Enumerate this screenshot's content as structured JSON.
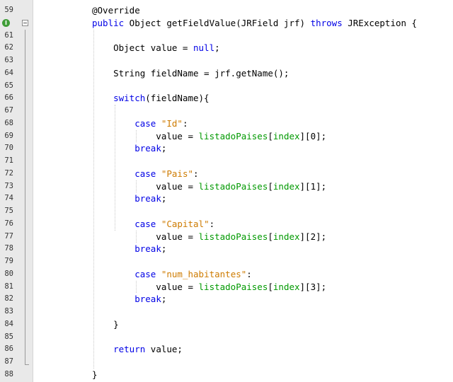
{
  "editor": {
    "override_marker": "I",
    "lines": [
      {
        "number": "59",
        "tokens": [
          {
            "t": "@Override",
            "k": "plain"
          }
        ]
      },
      {
        "number": "",
        "tokens": [
          {
            "t": "public",
            "k": "keyword"
          },
          {
            "t": " Object getFieldValue(JRField jrf) ",
            "k": "plain"
          },
          {
            "t": "throws",
            "k": "keyword"
          },
          {
            "t": " JRException {",
            "k": "plain"
          }
        ]
      },
      {
        "number": "61",
        "tokens": []
      },
      {
        "number": "62",
        "tokens": [
          {
            "t": "    Object value = ",
            "k": "plain"
          },
          {
            "t": "null",
            "k": "keyword"
          },
          {
            "t": ";",
            "k": "plain"
          }
        ]
      },
      {
        "number": "63",
        "tokens": []
      },
      {
        "number": "64",
        "tokens": [
          {
            "t": "    String fieldName = jrf.getName();",
            "k": "plain"
          }
        ]
      },
      {
        "number": "65",
        "tokens": []
      },
      {
        "number": "66",
        "tokens": [
          {
            "t": "    ",
            "k": "plain"
          },
          {
            "t": "switch",
            "k": "keyword"
          },
          {
            "t": "(fieldName){",
            "k": "plain"
          }
        ]
      },
      {
        "number": "67",
        "tokens": []
      },
      {
        "number": "68",
        "tokens": [
          {
            "t": "        ",
            "k": "plain"
          },
          {
            "t": "case",
            "k": "keyword"
          },
          {
            "t": " ",
            "k": "plain"
          },
          {
            "t": "\"Id\"",
            "k": "string"
          },
          {
            "t": ":",
            "k": "plain"
          }
        ]
      },
      {
        "number": "69",
        "tokens": [
          {
            "t": "            value = ",
            "k": "plain"
          },
          {
            "t": "listadoPaises",
            "k": "field"
          },
          {
            "t": "[",
            "k": "plain"
          },
          {
            "t": "index",
            "k": "field"
          },
          {
            "t": "][0];",
            "k": "plain"
          }
        ]
      },
      {
        "number": "70",
        "tokens": [
          {
            "t": "        ",
            "k": "plain"
          },
          {
            "t": "break",
            "k": "keyword"
          },
          {
            "t": ";",
            "k": "plain"
          }
        ]
      },
      {
        "number": "71",
        "tokens": []
      },
      {
        "number": "72",
        "tokens": [
          {
            "t": "        ",
            "k": "plain"
          },
          {
            "t": "case",
            "k": "keyword"
          },
          {
            "t": " ",
            "k": "plain"
          },
          {
            "t": "\"Pais\"",
            "k": "string"
          },
          {
            "t": ":",
            "k": "plain"
          }
        ]
      },
      {
        "number": "73",
        "tokens": [
          {
            "t": "            value = ",
            "k": "plain"
          },
          {
            "t": "listadoPaises",
            "k": "field"
          },
          {
            "t": "[",
            "k": "plain"
          },
          {
            "t": "index",
            "k": "field"
          },
          {
            "t": "][1];",
            "k": "plain"
          }
        ]
      },
      {
        "number": "74",
        "tokens": [
          {
            "t": "        ",
            "k": "plain"
          },
          {
            "t": "break",
            "k": "keyword"
          },
          {
            "t": ";",
            "k": "plain"
          }
        ]
      },
      {
        "number": "75",
        "tokens": []
      },
      {
        "number": "76",
        "tokens": [
          {
            "t": "        ",
            "k": "plain"
          },
          {
            "t": "case",
            "k": "keyword"
          },
          {
            "t": " ",
            "k": "plain"
          },
          {
            "t": "\"Capital\"",
            "k": "string"
          },
          {
            "t": ":",
            "k": "plain"
          }
        ]
      },
      {
        "number": "77",
        "tokens": [
          {
            "t": "            value = ",
            "k": "plain"
          },
          {
            "t": "listadoPaises",
            "k": "field"
          },
          {
            "t": "[",
            "k": "plain"
          },
          {
            "t": "index",
            "k": "field"
          },
          {
            "t": "][2];",
            "k": "plain"
          }
        ]
      },
      {
        "number": "78",
        "tokens": [
          {
            "t": "        ",
            "k": "plain"
          },
          {
            "t": "break",
            "k": "keyword"
          },
          {
            "t": ";",
            "k": "plain"
          }
        ]
      },
      {
        "number": "79",
        "tokens": []
      },
      {
        "number": "80",
        "tokens": [
          {
            "t": "        ",
            "k": "plain"
          },
          {
            "t": "case",
            "k": "keyword"
          },
          {
            "t": " ",
            "k": "plain"
          },
          {
            "t": "\"num_habitantes\"",
            "k": "string"
          },
          {
            "t": ":",
            "k": "plain"
          }
        ]
      },
      {
        "number": "81",
        "tokens": [
          {
            "t": "            value = ",
            "k": "plain"
          },
          {
            "t": "listadoPaises",
            "k": "field"
          },
          {
            "t": "[",
            "k": "plain"
          },
          {
            "t": "index",
            "k": "field"
          },
          {
            "t": "][3];",
            "k": "plain"
          }
        ]
      },
      {
        "number": "82",
        "tokens": [
          {
            "t": "        ",
            "k": "plain"
          },
          {
            "t": "break",
            "k": "keyword"
          },
          {
            "t": ";",
            "k": "plain"
          }
        ]
      },
      {
        "number": "83",
        "tokens": []
      },
      {
        "number": "84",
        "tokens": [
          {
            "t": "    }",
            "k": "plain"
          }
        ]
      },
      {
        "number": "85",
        "tokens": []
      },
      {
        "number": "86",
        "tokens": [
          {
            "t": "    ",
            "k": "plain"
          },
          {
            "t": "return",
            "k": "keyword"
          },
          {
            "t": " value;",
            "k": "plain"
          }
        ]
      },
      {
        "number": "87",
        "tokens": []
      },
      {
        "number": "88",
        "tokens": [
          {
            "t": "}",
            "k": "plain"
          }
        ]
      }
    ]
  }
}
